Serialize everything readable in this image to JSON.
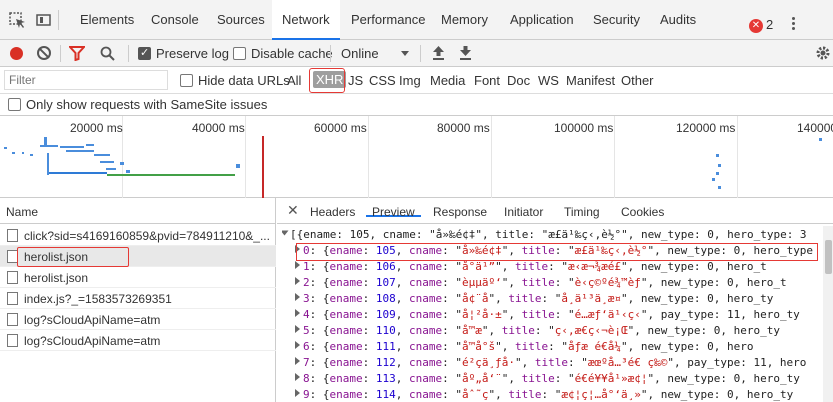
{
  "tabs": [
    "Elements",
    "Console",
    "Sources",
    "Network",
    "Performance",
    "Memory",
    "Application",
    "Security",
    "Audits"
  ],
  "active_tab": "Network",
  "error_count": "2",
  "toolbar": {
    "preserve_log": "Preserve log",
    "disable_cache": "Disable cache",
    "throttle": "Online"
  },
  "filter": {
    "placeholder": "Filter",
    "hide_data_urls": "Hide data URLs",
    "types": [
      "All",
      "XHR",
      "JS",
      "CSS",
      "Img",
      "Media",
      "Font",
      "Doc",
      "WS",
      "Manifest",
      "Other"
    ],
    "active_type": "XHR"
  },
  "samesite_label": "Only show requests with SameSite issues",
  "timeline": {
    "ticks": [
      "20000 ms",
      "40000 ms",
      "60000 ms",
      "80000 ms",
      "100000 ms",
      "120000 ms",
      "140000"
    ]
  },
  "requests": {
    "header": "Name",
    "rows": [
      "click?sid=s4169160859&pvid=784911210&_...",
      "herolist.json",
      "herolist.json",
      "index.js?_=1583573269351",
      "log?sCloudApiName=atm",
      "log?sCloudApiName=atm"
    ]
  },
  "detail": {
    "tabs": [
      "Headers",
      "Preview",
      "Response",
      "Initiator",
      "Timing",
      "Cookies"
    ],
    "active": "Preview",
    "summary": "[{ename: 105, cname: \"å»‰é¢‡\", title: \"æ£ä¹‰ç‹‚è½°\", new_type: 0, hero_type: 3",
    "items": [
      {
        "idx": "0",
        "ename": "105",
        "cname": "å»‰é¢‡",
        "title": "æ£ä¹‰ç‹‚è½°",
        "tail": "new_type: 0, hero_type"
      },
      {
        "idx": "1",
        "ename": "106",
        "cname": "å°ä¹”",
        "title": "æ‹æ¬¾æé£",
        "tail": "new_type: 0, hero_t"
      },
      {
        "idx": "2",
        "ename": "107",
        "cname": "èµµäº‘",
        "title": "è‹ç©ºé¾™èƒ",
        "tail": "new_type: 0, hero_t"
      },
      {
        "idx": "3",
        "ename": "108",
        "cname": "å¢¨å­",
        "title": "å¸ä¹³ä¸æ¤",
        "tail": "new_type: 0, hero_ty"
      },
      {
        "idx": "4",
        "ename": "109",
        "cname": "å¦²å·±",
        "title": "é­…æƒ‘ä¹‹ç‹",
        "tail": "pay_type: 11, hero_ty"
      },
      {
        "idx": "5",
        "ename": "110",
        "cname": "å­™æ",
        "title": "ç‹‚æ€ç‹¬è¡Œ",
        "tail": "new_type: 0, hero_ty"
      },
      {
        "idx": "6",
        "ename": "111",
        "cname": "å­™å°š",
        "title": "åƒæ é€å¼",
        "tail": "new_type: 0, hero"
      },
      {
        "idx": "7",
        "ename": "112",
        "cname": "é²ç­ä¸ƒå·",
        "title": "æœºå…³é€ ç‰©",
        "tail": "pay_type: 11, hero"
      },
      {
        "idx": "8",
        "ename": "113",
        "cname": "åº„å‘¨",
        "title": "é€é¥¥å¹»æ¢¦",
        "tail": "new_type: 0, hero_ty"
      },
      {
        "idx": "9",
        "ename": "114",
        "cname": "åˆ˜ç",
        "title": "æ¢¦ç¦…å°‘ä¸»",
        "tail": "new_type: 0, hero_ty"
      }
    ]
  },
  "colors": {
    "accent": "#1a73e8",
    "record": "#d93025",
    "highlight": "#e53935"
  }
}
